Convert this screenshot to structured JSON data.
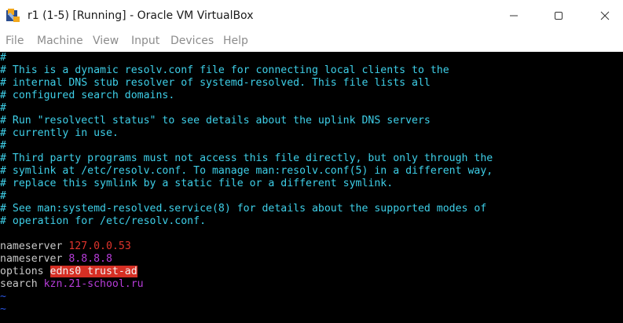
{
  "window": {
    "title": "r1 (1-5) [Running] - Oracle VM VirtualBox",
    "icon": "virtualbox-icon"
  },
  "menubar": {
    "items": [
      "File",
      "Machine",
      "View",
      "Input",
      "Devices",
      "Help"
    ]
  },
  "editor": {
    "comments": [
      "#",
      "# This is a dynamic resolv.conf file for connecting local clients to the",
      "# internal DNS stub resolver of systemd-resolved. This file lists all",
      "# configured search domains.",
      "#",
      "# Run \"resolvectl status\" to see details about the uplink DNS servers",
      "# currently in use.",
      "#",
      "# Third party programs must not access this file directly, but only through the",
      "# symlink at /etc/resolv.conf. To manage man:resolv.conf(5) in a different way,",
      "# replace this symlink by a static file or a different symlink.",
      "#",
      "# See man:systemd-resolved.service(8) for details about the supported modes of",
      "# operation for /etc/resolv.conf."
    ],
    "config": {
      "ns1_key": "nameserver",
      "ns1_value": "127.0.0.53",
      "ns2_key": "nameserver",
      "ns2_value": "8.8.8.8",
      "options_key": "options",
      "options_value": "edns0 trust-ad",
      "search_key": "search",
      "search_value": "kzn.21-school.ru"
    },
    "empty_line_marker": "~"
  },
  "colors": {
    "comment": "#3ecfe8",
    "ip_red": "#e0342c",
    "ip_purple": "#b63cd8",
    "highlight": "#d62f24",
    "tilde": "#2b57e6"
  }
}
